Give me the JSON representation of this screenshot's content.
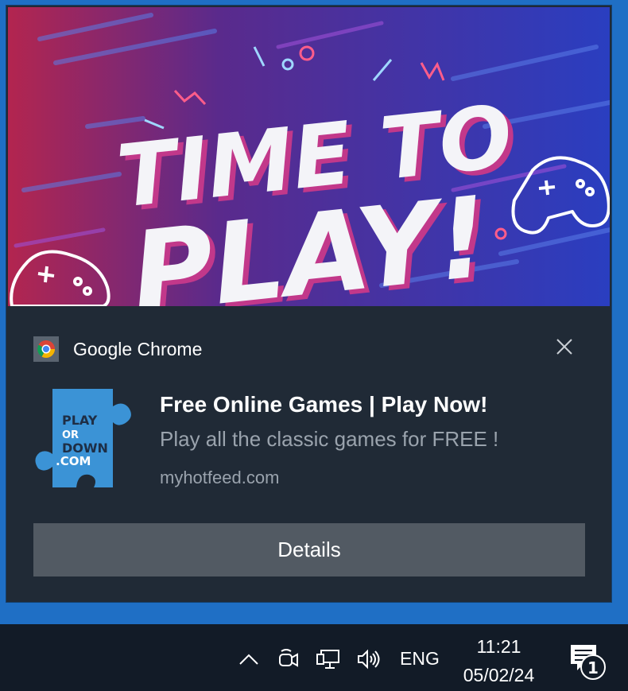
{
  "notification": {
    "app_name": "Google Chrome",
    "title": "Free Online Games | Play Now!",
    "body": "Play all the classic games for FREE !",
    "attribution": "myhotfeed.com",
    "action_label": "Details",
    "hero_banner": {
      "headline_line1": "TIME TO",
      "headline_line2": "PLAY!"
    },
    "app_icon": {
      "line1": "PLAY",
      "line2": "OR",
      "line3": "DOWN",
      "line4": ".COM"
    },
    "icons": [
      "chrome-icon",
      "close-icon",
      "puzzle-piece-icon",
      "gamepad-icon"
    ]
  },
  "taskbar": {
    "language": "ENG",
    "time": "11:21",
    "date": "05/02/24",
    "notification_count": "1",
    "icons": [
      "chevron-up-icon",
      "meet-now-icon",
      "network-icon",
      "volume-icon",
      "action-center-icon"
    ]
  },
  "colors": {
    "toast_bg": "#202a36",
    "button_bg": "#525a63",
    "taskbar_bg": "#121b27",
    "desktop_bg": "#1f6fc5",
    "puzzle_blue": "#3b93d6"
  }
}
